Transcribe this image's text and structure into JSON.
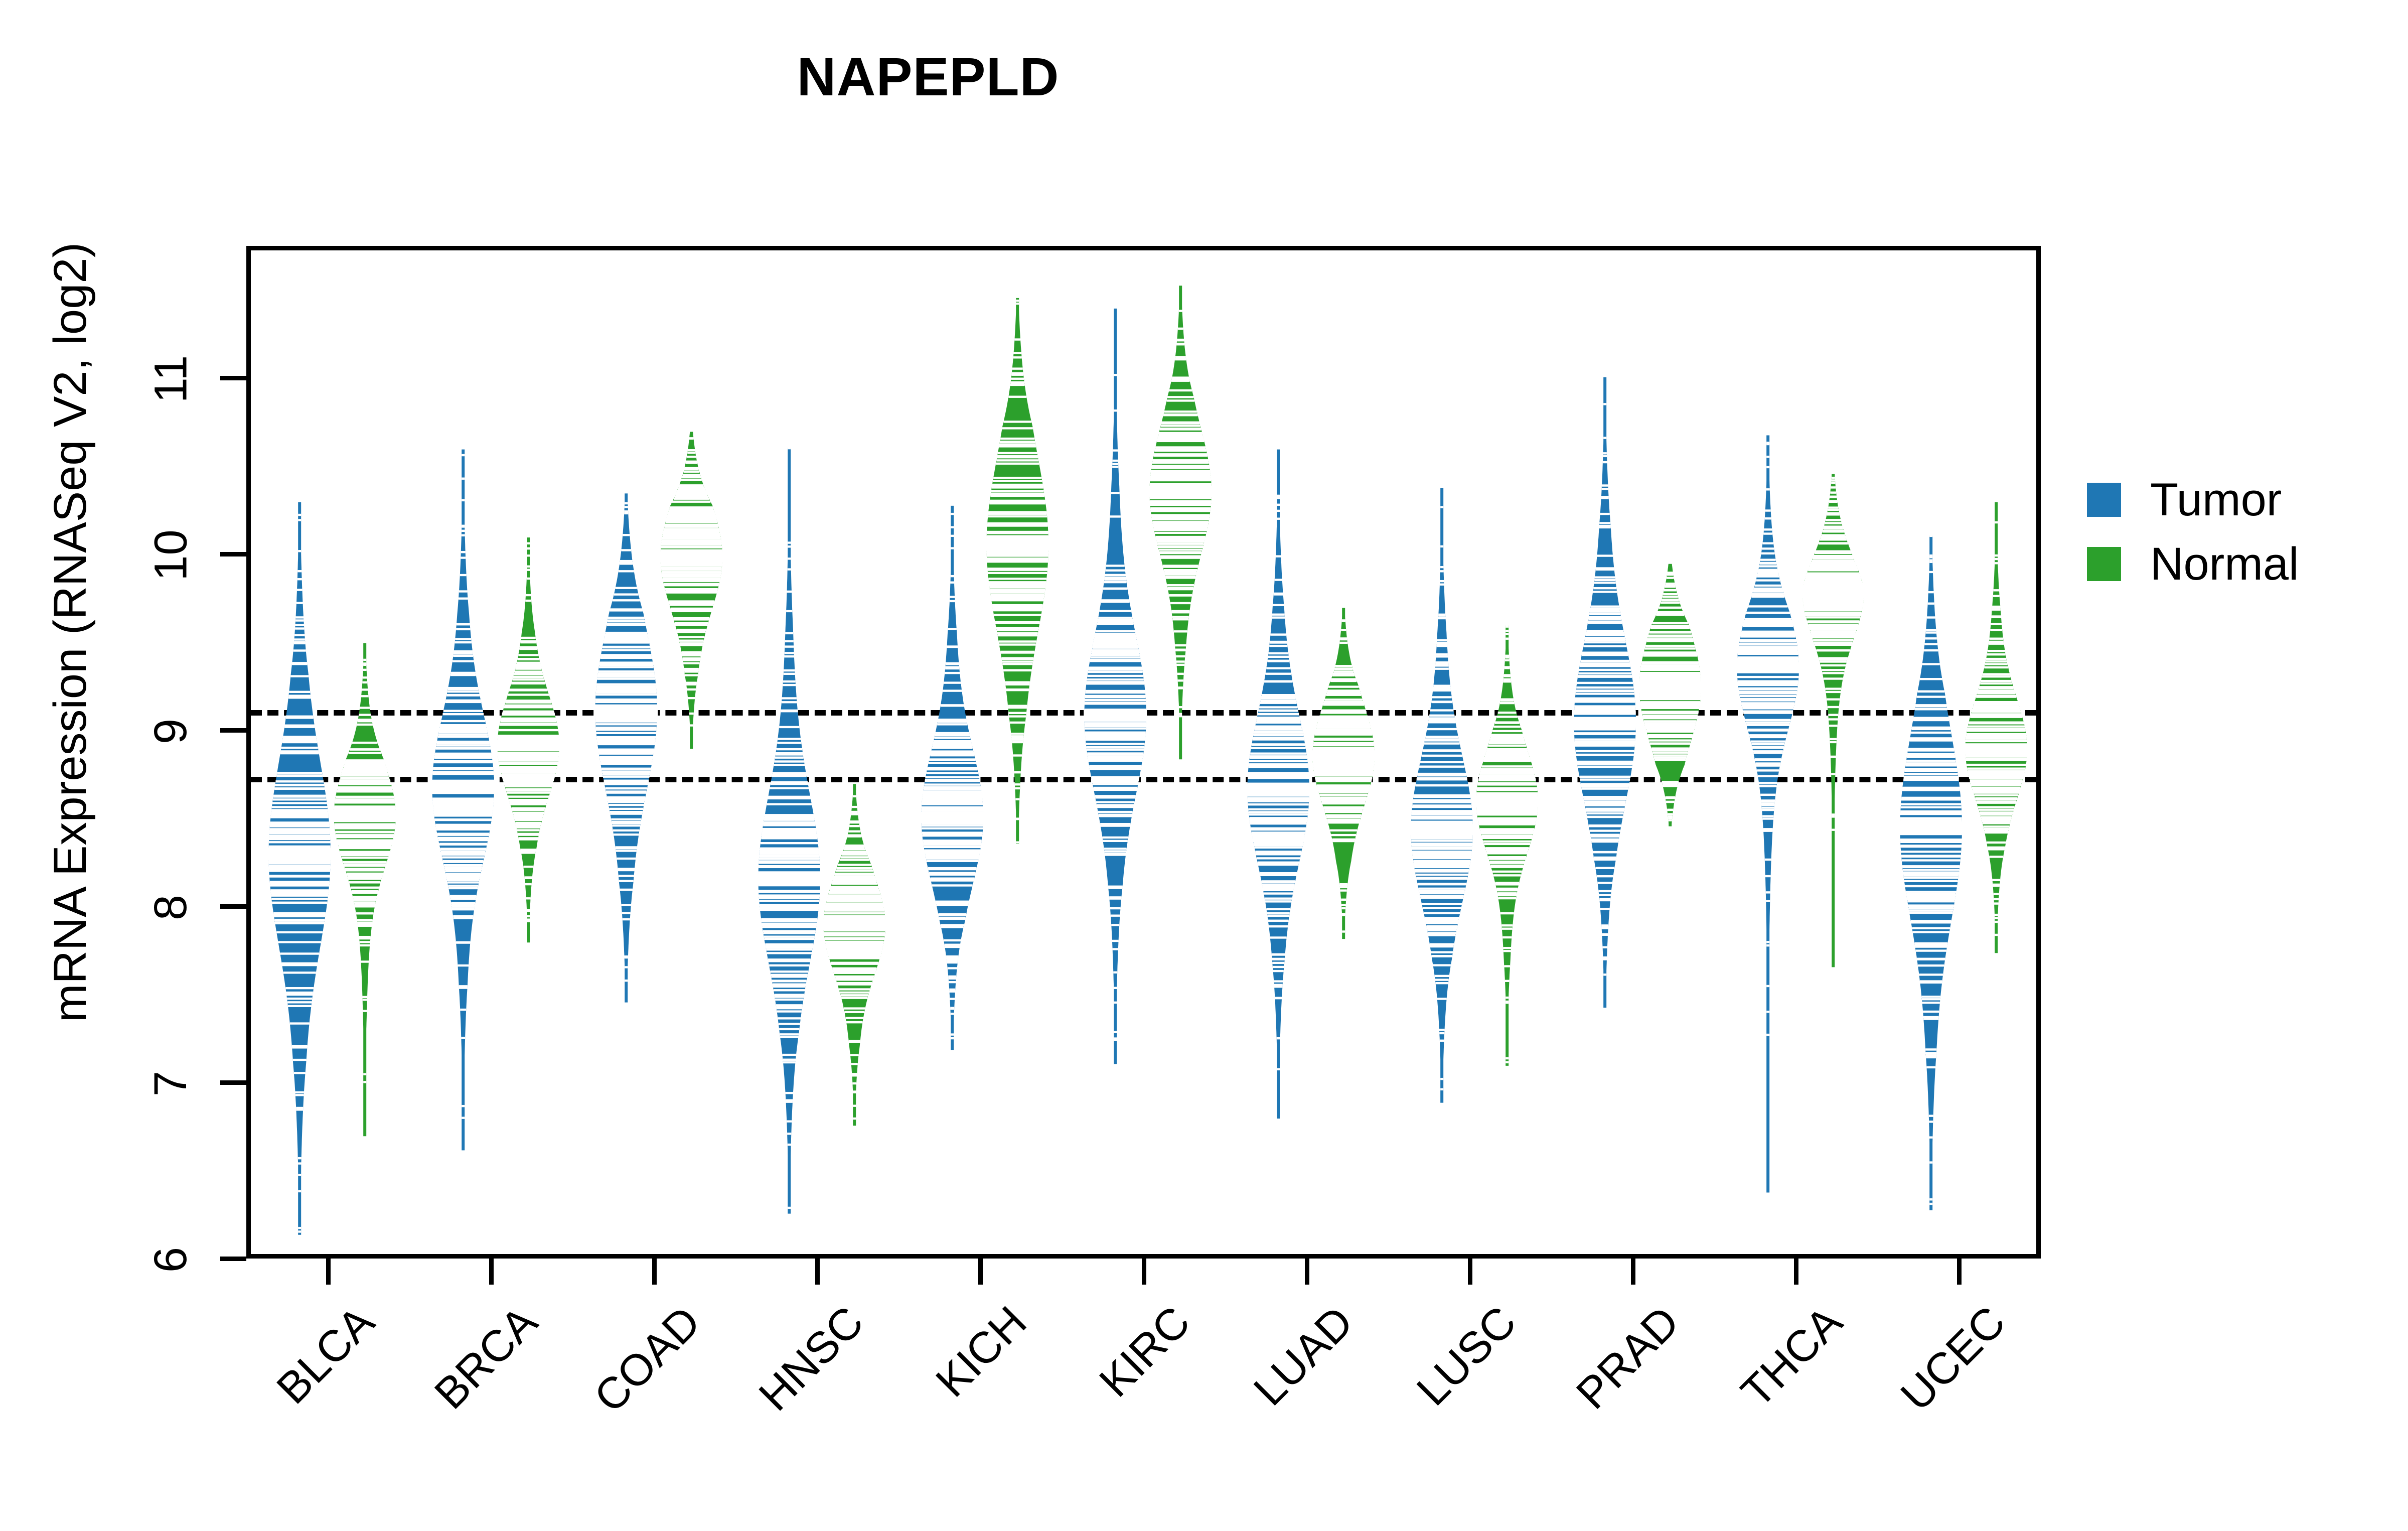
{
  "chart_data": {
    "type": "violin",
    "title": "NAPEPLD",
    "xlabel": "",
    "ylabel": "mRNA Expression (RNASeq V2, log2)",
    "ylim": [
      6,
      11.75
    ],
    "yticks": [
      6,
      7,
      8,
      9,
      10,
      11
    ],
    "ytick_labels": [
      "6",
      "7",
      "8",
      "9",
      "10",
      "11"
    ],
    "grid": false,
    "legend_position": "right",
    "reference_lines": [
      9.14,
      8.76
    ],
    "categories": [
      "BLCA",
      "BRCA",
      "COAD",
      "HNSC",
      "KICH",
      "KIRC",
      "LUAD",
      "LUSC",
      "PRAD",
      "THCA",
      "UCEC"
    ],
    "series": [
      {
        "name": "Tumor",
        "color": "#1f77b4",
        "medians": [
          8.32,
          8.7,
          9.14,
          8.18,
          8.53,
          9.11,
          8.69,
          8.46,
          9.07,
          9.38,
          8.47
        ],
        "q1": [
          7.95,
          8.42,
          8.8,
          7.85,
          8.28,
          8.78,
          8.4,
          8.18,
          8.75,
          9.12,
          8.12
        ],
        "q3": [
          8.72,
          9.02,
          9.46,
          8.55,
          8.84,
          9.44,
          9.02,
          8.78,
          9.42,
          9.62,
          8.88
        ],
        "min": [
          6.16,
          6.64,
          7.48,
          6.28,
          7.21,
          7.13,
          6.82,
          6.91,
          7.45,
          6.4,
          6.3
        ],
        "max": [
          10.32,
          10.62,
          10.37,
          10.63,
          10.3,
          11.42,
          10.62,
          10.4,
          11.03,
          10.7,
          10.13
        ]
      },
      {
        "name": "Normal",
        "color": "#2ca02c",
        "medians": [
          8.54,
          8.94,
          10.01,
          7.92,
          10.08,
          10.38,
          8.88,
          8.62,
          9.27,
          9.82,
          8.92
        ],
        "q1": [
          8.34,
          8.72,
          9.8,
          7.72,
          9.7,
          10.12,
          8.68,
          8.42,
          9.06,
          9.62,
          8.7
        ],
        "q3": [
          8.76,
          9.14,
          10.24,
          8.12,
          10.42,
          10.64,
          9.1,
          8.84,
          9.52,
          10.02,
          9.12
        ],
        "min": [
          6.72,
          7.82,
          8.92,
          6.78,
          8.38,
          8.86,
          7.84,
          7.12,
          8.48,
          7.68,
          7.76
        ],
        "max": [
          9.52,
          10.12,
          10.72,
          8.72,
          11.48,
          11.55,
          9.72,
          9.62,
          9.97,
          10.48,
          10.32
        ]
      }
    ]
  },
  "legend": {
    "items": [
      {
        "label": "Tumor",
        "color": "#1f77b4"
      },
      {
        "label": "Normal",
        "color": "#2ca02c"
      }
    ]
  }
}
